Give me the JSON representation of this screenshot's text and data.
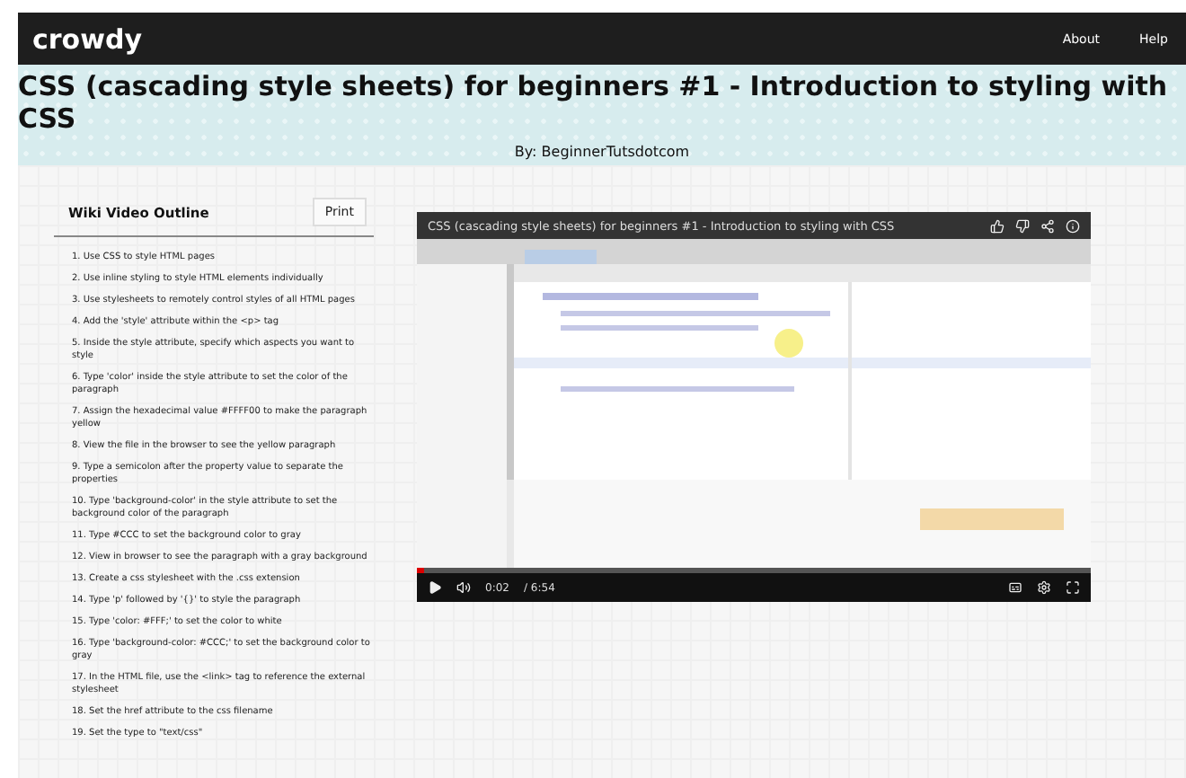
{
  "header": {
    "logo": "crowdy",
    "nav": [
      "About",
      "Help"
    ]
  },
  "hero": {
    "title": "CSS (cascading style sheets) for beginners #1 - Introduction to styling with CSS",
    "byline": "By: BeginnerTutsdotcom"
  },
  "outline": {
    "title": "Wiki Video Outline",
    "print_button": "Print",
    "items": [
      "1. Use CSS to style HTML pages",
      "2. Use inline styling to style HTML elements individually",
      "3. Use stylesheets to remotely control styles of all HTML pages",
      "4. Add the 'style' attribute within the <p> tag",
      "5. Inside the style attribute, specify which aspects you want to style",
      "6. Type 'color' inside the style attribute to set the color of the paragraph",
      "7. Assign the hexadecimal value #FFFF00 to make the paragraph yellow",
      "8. View the file in the browser to see the yellow paragraph",
      "9. Type a semicolon after the property value to separate the properties",
      "10. Type 'background-color' in the style attribute to set the background color of the paragraph",
      "11. Type #CCC to set the background color to gray",
      "12. View in browser to see the paragraph with a gray background",
      "13. Create a css stylesheet with the .css extension",
      "14. Type 'p' followed by '{}' to style the paragraph",
      "15. Type 'color: #FFF;' to set the color to white",
      "16. Type 'background-color: #CCC;' to set the background color to gray",
      "17. In the HTML file, use the <link> tag to reference the external stylesheet",
      "18. Set the href attribute to the css filename",
      "19. Set the type to \"text/css\""
    ]
  },
  "video": {
    "title": "CSS (cascading style sheets) for beginners #1 - Introduction to styling with CSS",
    "time_current": "0:02",
    "time_total": "/ 6:54",
    "progress": {
      "level": 0.01
    }
  }
}
